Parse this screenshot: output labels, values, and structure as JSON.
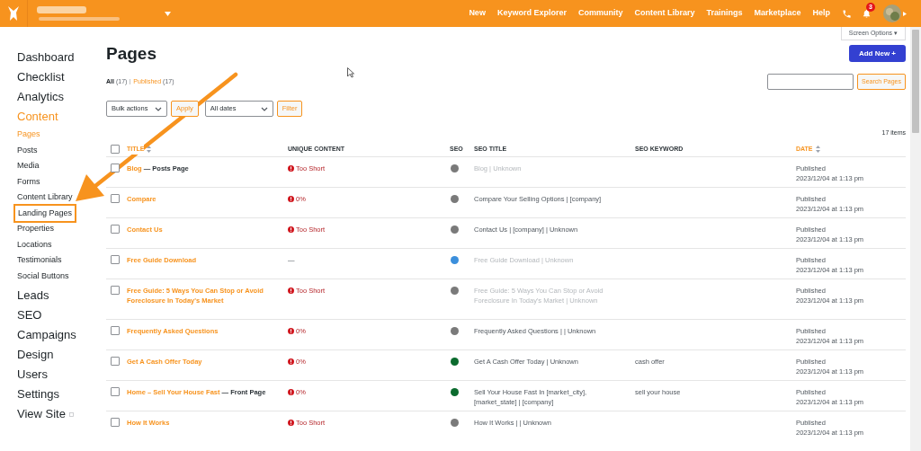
{
  "topbar": {
    "nav": [
      "New",
      "Keyword Explorer",
      "Community",
      "Content Library",
      "Trainings",
      "Marketplace",
      "Help"
    ],
    "notification_count": "3"
  },
  "screen_options": "Screen Options ▾",
  "sidebar": {
    "items": [
      {
        "label": "Dashboard",
        "selected": false
      },
      {
        "label": "Checklist",
        "selected": false
      },
      {
        "label": "Analytics",
        "selected": false
      },
      {
        "label": "Content",
        "selected": true,
        "children": [
          {
            "label": "Pages",
            "selected": true,
            "highlighted": false
          },
          {
            "label": "Posts",
            "selected": false,
            "highlighted": false
          },
          {
            "label": "Media",
            "selected": false,
            "highlighted": false
          },
          {
            "label": "Forms",
            "selected": false,
            "highlighted": false
          },
          {
            "label": "Content Library",
            "selected": false,
            "highlighted": false
          },
          {
            "label": "Landing Pages",
            "selected": false,
            "highlighted": true
          },
          {
            "label": "Properties",
            "selected": false,
            "highlighted": false
          },
          {
            "label": "Locations",
            "selected": false,
            "highlighted": false
          },
          {
            "label": "Testimonials",
            "selected": false,
            "highlighted": false
          },
          {
            "label": "Social Buttons",
            "selected": false,
            "highlighted": false
          }
        ]
      },
      {
        "label": "Leads",
        "selected": false
      },
      {
        "label": "SEO",
        "selected": false
      },
      {
        "label": "Campaigns",
        "selected": false
      },
      {
        "label": "Design",
        "selected": false
      },
      {
        "label": "Users",
        "selected": false
      },
      {
        "label": "Settings",
        "selected": false
      },
      {
        "label": "View Site",
        "selected": false
      }
    ]
  },
  "select_all_checked": false,
  "page_title": "Pages",
  "add_new": "Add New +",
  "filters": [
    {
      "label": "All",
      "count": "(17)",
      "selected": true
    },
    {
      "label": "Published",
      "count": "(17)",
      "selected": false
    }
  ],
  "search_button": "Search Pages",
  "bulk_actions": "Bulk actions",
  "apply": "Apply",
  "dates": "All dates",
  "filter": "Filter",
  "item_count": "17 items",
  "columns": [
    {
      "label": "TITLE",
      "sortable": true
    },
    {
      "label": "UNIQUE CONTENT",
      "sortable": false
    },
    {
      "label": "SEO",
      "sortable": false
    },
    {
      "label": "SEO TITLE",
      "sortable": false
    },
    {
      "label": "SEO KEYWORD",
      "sortable": false
    },
    {
      "label": "DATE",
      "sortable": true
    }
  ],
  "rows": [
    {
      "checked": false,
      "title": "Blog",
      "suffix": "— Posts Page",
      "unique": {
        "kind": "warning",
        "text": "Too Short"
      },
      "color": "#7a7a7a",
      "seo_title": "Blog | Unknown",
      "seo_muted": true,
      "status": "Published",
      "date": "2023/12/04 at 1:13 pm"
    },
    {
      "checked": false,
      "title": "Compare",
      "unique": {
        "kind": "warning",
        "text": "0%"
      },
      "color": "#7a7a7a",
      "seo_title": "Compare Your Selling Options | [company]",
      "seo_muted": false,
      "status": "Published",
      "date": "2023/12/04 at 1:13 pm"
    },
    {
      "checked": false,
      "title": "Contact Us",
      "unique": {
        "kind": "warning",
        "text": "Too Short"
      },
      "color": "#7a7a7a",
      "seo_title": "Contact Us | [company] | Unknown",
      "seo_muted": false,
      "status": "Published",
      "date": "2023/12/04 at 1:13 pm"
    },
    {
      "checked": false,
      "title": "Free Guide Download",
      "unique": {
        "kind": "none",
        "text": "—"
      },
      "color": "#3b8fdc",
      "seo_title": "Free Guide Download | Unknown",
      "seo_muted": true,
      "status": "Published",
      "date": "2023/12/04 at 1:13 pm"
    },
    {
      "checked": false,
      "title": "Free Guide: 5 Ways You Can Stop or Avoid Foreclosure In Today's Market",
      "unique": {
        "kind": "warning",
        "text": "Too Short"
      },
      "color": "#7a7a7a",
      "seo_title": "Free Guide: 5 Ways You Can Stop or Avoid Foreclosure In Today's Market | Unknown",
      "seo_muted": true,
      "status": "Published",
      "date": "2023/12/04 at 1:13 pm"
    },
    {
      "checked": false,
      "title": "Frequently Asked Questions",
      "unique": {
        "kind": "warning",
        "text": "0%"
      },
      "color": "#7a7a7a",
      "seo_title": "Frequently Asked Questions | | Unknown",
      "seo_muted": false,
      "status": "Published",
      "date": "2023/12/04 at 1:13 pm"
    },
    {
      "checked": false,
      "title": "Get A Cash Offer Today",
      "unique": {
        "kind": "warning",
        "text": "0%"
      },
      "color": "#0b6b2e",
      "seo_title": "Get A Cash Offer Today | Unknown",
      "seo_muted": false,
      "keyword": "cash offer",
      "status": "Published",
      "date": "2023/12/04 at 1:13 pm"
    },
    {
      "checked": false,
      "title": "Home – Sell Your House Fast",
      "suffix": "— Front Page",
      "unique": {
        "kind": "warning",
        "text": "0%"
      },
      "color": "#0b6b2e",
      "seo_title": "Sell Your House Fast In [market_city], [market_state] | [company]",
      "seo_muted": false,
      "keyword": "sell your house",
      "status": "Published",
      "date": "2023/12/04 at 1:13 pm"
    },
    {
      "checked": false,
      "title": "How It Works",
      "unique": {
        "kind": "warning",
        "text": "Too Short"
      },
      "color": "#7a7a7a",
      "seo_title": "How It Works | | Unknown",
      "seo_muted": false,
      "status": "Published",
      "date": "2023/12/04 at 1:13 pm"
    }
  ]
}
